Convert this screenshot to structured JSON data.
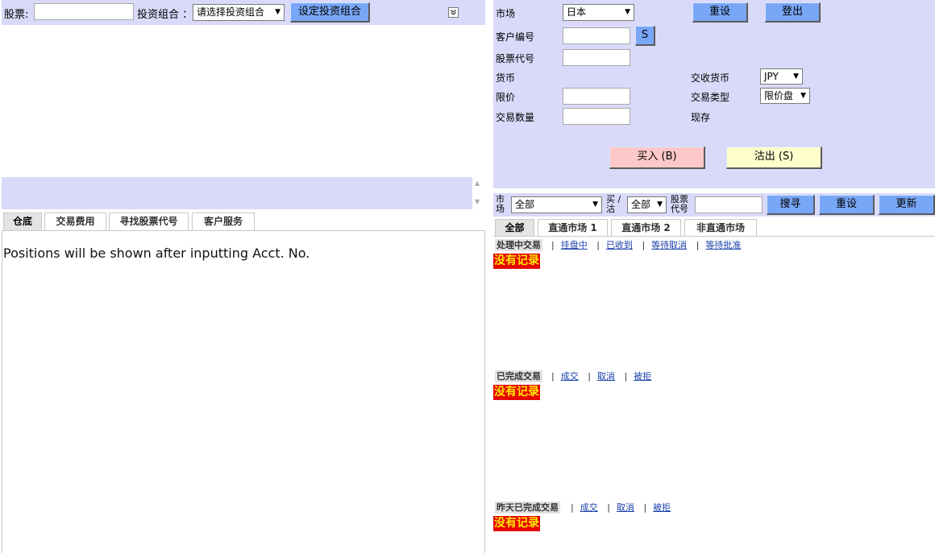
{
  "left": {
    "toolbar": {
      "stock_label": "股票:",
      "stock_value": "",
      "portfolio_label": "投资组合 ：",
      "portfolio_select": "请选择投资组合",
      "set_portfolio_btn": "设定投资组合"
    },
    "scroll": {
      "up": "▲",
      "down": "▼"
    },
    "tabs": [
      "仓底",
      "交易费用",
      "寻找股票代号",
      "客户服务"
    ],
    "positions_message": "Positions will be shown after inputting Acct. No."
  },
  "order_form": {
    "market_label": "市场",
    "market_value": "日本",
    "reset_btn": "重设",
    "logout_btn": "登出",
    "client_no_label": "客户编号",
    "client_no_value": "",
    "s_btn": "S",
    "stock_code_label": "股票代号",
    "stock_code_value": "",
    "currency_label": "货币",
    "settle_currency_label": "交收货币",
    "settle_currency_value": "JPY",
    "limit_price_label": "限价",
    "limit_price_value": "",
    "order_type_label": "交易类型",
    "order_type_value": "限价盘",
    "quantity_label": "交易数量",
    "quantity_value": "",
    "on_hand_label": "现存",
    "buy_btn": "买入 (B)",
    "sell_btn": "沽出 (S)"
  },
  "filter": {
    "market_label_1": "市",
    "market_label_2": "场",
    "market_value": "全部",
    "side_label_1": "买 /",
    "side_label_2": "沽",
    "side_value": "全部",
    "code_label_1": "股票",
    "code_label_2": "代号",
    "code_value": "",
    "search_btn": "搜寻",
    "reset_btn": "重设",
    "refresh_btn": "更新"
  },
  "market_tabs": [
    "全部",
    "直通市场 1",
    "直通市场 2",
    "非直通市场"
  ],
  "sections": [
    {
      "title": "处理中交易",
      "links": [
        "挂盘中",
        "已收到",
        "等待取消",
        "等待批准"
      ],
      "empty": "没有记录"
    },
    {
      "title": "已完成交易",
      "links": [
        "成交",
        "取消",
        "被拒"
      ],
      "empty": "没有记录"
    },
    {
      "title": "昨天已完成交易",
      "links": [
        "成交",
        "取消",
        "被拒"
      ],
      "empty": "没有记录"
    }
  ],
  "colors": {
    "panel": "#d9d9f9",
    "button": "#79a7f7",
    "buy": "#ffc8c8",
    "sell": "#ffffcc",
    "no_record_bg": "#e60000",
    "no_record_text": "#ffea00"
  },
  "icons": {
    "collapse": "collapse-icon"
  }
}
